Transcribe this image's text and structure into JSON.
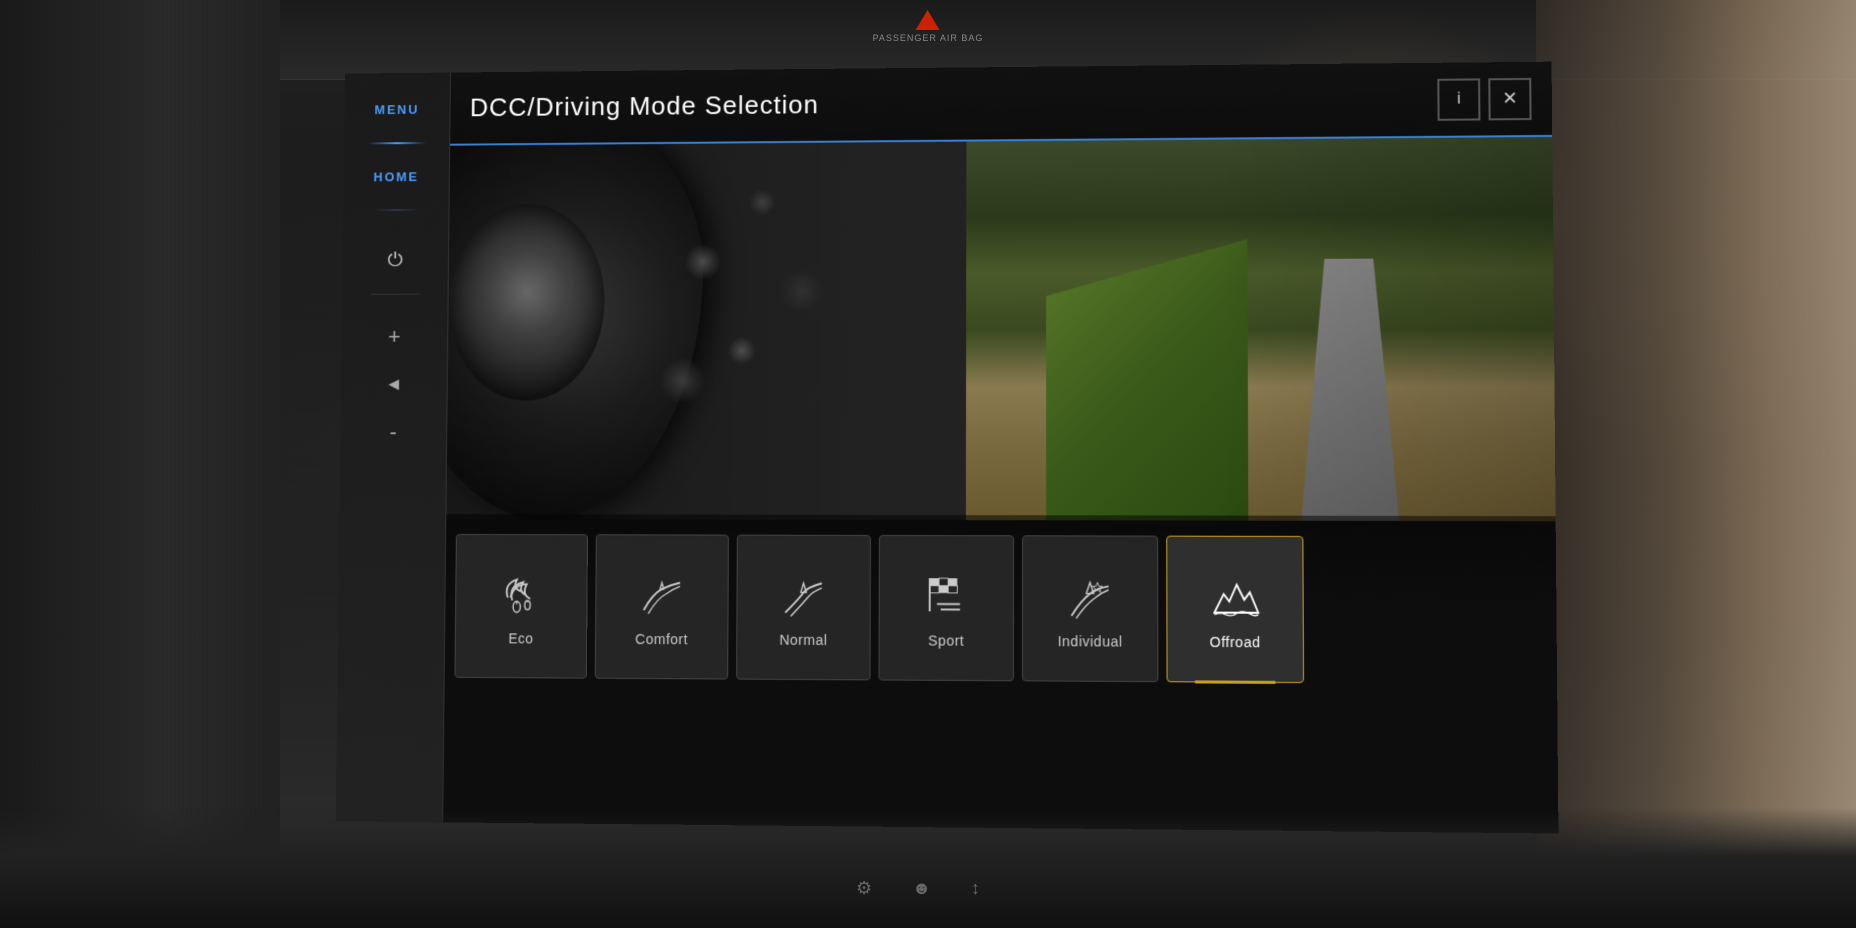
{
  "header": {
    "hazard_label": "PASSENGER AIRBAG",
    "passenger_text": "PASSENGER\nAIR BAG"
  },
  "sidebar": {
    "menu_label": "MENU",
    "home_label": "HOME",
    "power_symbol": "⏻",
    "vol_plus": "+",
    "back_symbol": "◄",
    "vol_minus": "-"
  },
  "screen": {
    "title": "DCC/Driving Mode Selection",
    "info_btn": "i",
    "close_btn": "✕"
  },
  "modes": [
    {
      "id": "eco",
      "label": "Eco",
      "active": false
    },
    {
      "id": "comfort",
      "label": "Comfort",
      "active": false
    },
    {
      "id": "normal",
      "label": "Normal",
      "active": false
    },
    {
      "id": "sport",
      "label": "Sport",
      "active": false
    },
    {
      "id": "individual",
      "label": "Individual",
      "active": false
    },
    {
      "id": "offroad",
      "label": "Offroad",
      "active": true
    }
  ]
}
